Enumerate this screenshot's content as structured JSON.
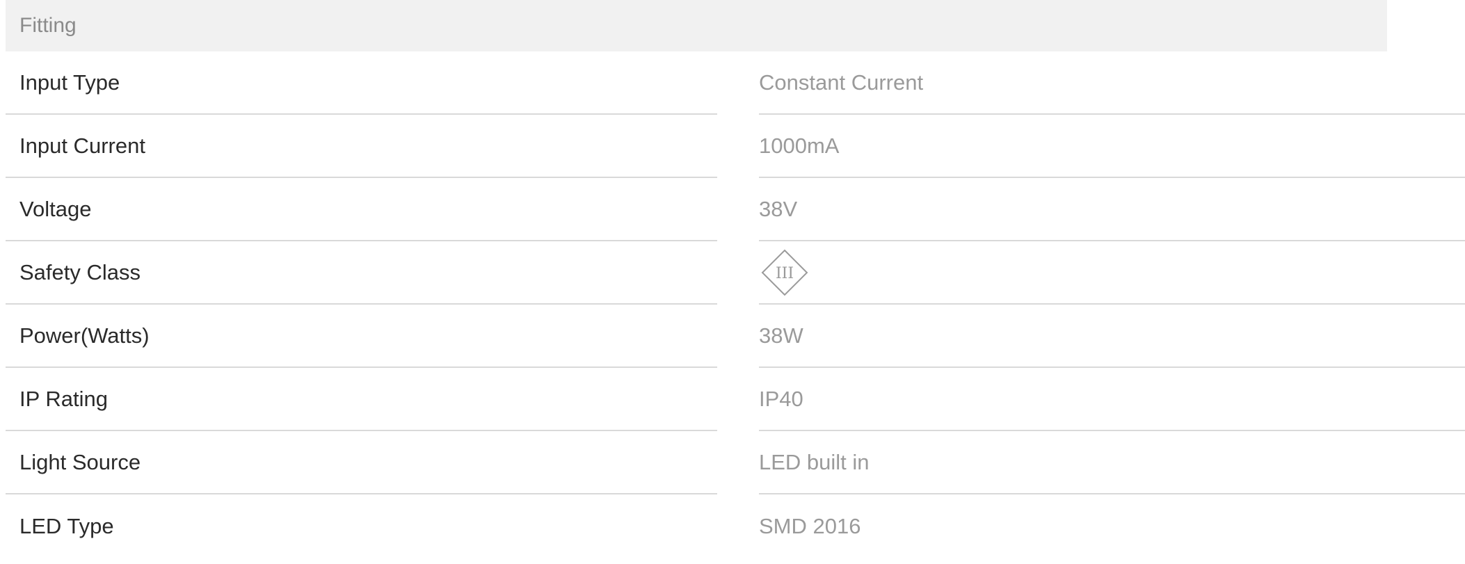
{
  "section": {
    "title": "Fitting"
  },
  "specs": [
    {
      "label": "Input Type",
      "value": "Constant Current"
    },
    {
      "label": "Input Current",
      "value": "1000mA"
    },
    {
      "label": "Voltage",
      "value": "38V"
    },
    {
      "label": "Safety Class",
      "value": "",
      "icon": "class-iii-safety-icon",
      "icon_text": "III"
    },
    {
      "label": "Power(Watts)",
      "value": "38W"
    },
    {
      "label": "IP Rating",
      "value": "IP40"
    },
    {
      "label": "Light Source",
      "value": "LED built in"
    },
    {
      "label": "LED Type",
      "value": "SMD 2016"
    }
  ],
  "colors": {
    "header_bg": "#f1f1f1",
    "label_text": "#2a2a2a",
    "value_text": "#9a9a9a",
    "divider": "#d9d9d9"
  }
}
